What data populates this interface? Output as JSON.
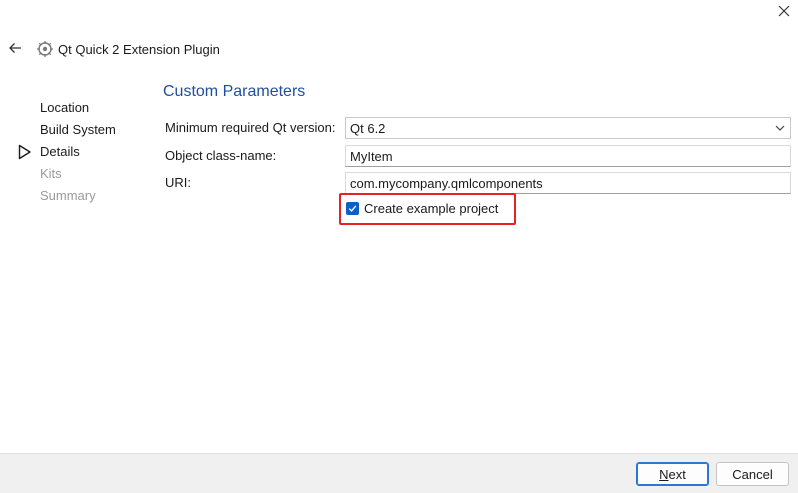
{
  "window": {
    "title": "Qt Quick 2 Extension Plugin",
    "icons": {
      "close": "close-icon",
      "back": "arrow-left-icon",
      "wizard": "wizard-icon"
    }
  },
  "steps": [
    {
      "label": "Location",
      "state": "done"
    },
    {
      "label": "Build System",
      "state": "done"
    },
    {
      "label": "Details",
      "state": "current"
    },
    {
      "label": "Kits",
      "state": "pending"
    },
    {
      "label": "Summary",
      "state": "pending"
    }
  ],
  "form": {
    "section_title": "Custom Parameters",
    "qt_version": {
      "label": "Minimum required Qt version:",
      "value": "Qt 6.2"
    },
    "class_name": {
      "label": "Object class-name:",
      "value": "MyItem"
    },
    "uri": {
      "label": "URI:",
      "value": "com.mycompany.qmlcomponents"
    },
    "example_project": {
      "label": "Create example project",
      "checked": true
    }
  },
  "footer": {
    "next": {
      "mnemonic": "N",
      "rest": "ext"
    },
    "cancel": "Cancel"
  },
  "colors": {
    "section_title": "#1f4e9c",
    "checkbox": "#0a5fc8",
    "highlight": "#e8231f",
    "muted": "#9a9a9a"
  }
}
